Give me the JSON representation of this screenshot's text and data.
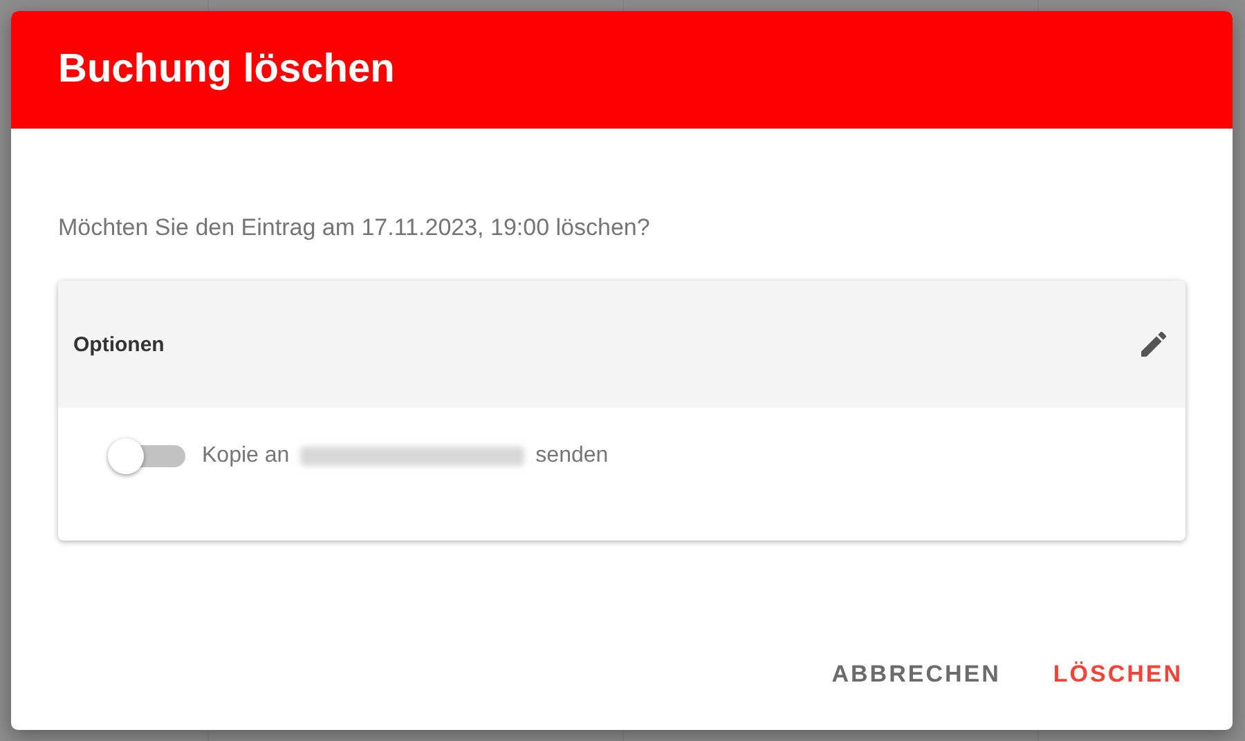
{
  "dialog": {
    "title": "Buchung löschen",
    "message": "Möchten Sie den Eintrag am 17.11.2023, 19:00 löschen?",
    "options": {
      "title": "Optionen",
      "toggle": {
        "on": false,
        "label_before": "Kopie an",
        "label_after": "senden"
      }
    },
    "buttons": [
      {
        "label": "ABBRECHEN",
        "kind": "cancel"
      },
      {
        "label": "LÖSCHEN",
        "kind": "danger"
      }
    ]
  }
}
